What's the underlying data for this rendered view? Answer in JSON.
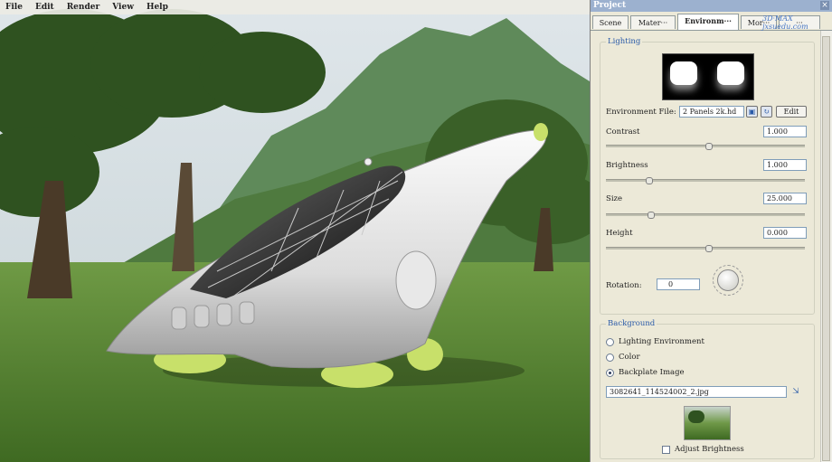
{
  "menu": [
    "File",
    "Edit",
    "Render",
    "View",
    "Help"
  ],
  "panel": {
    "title": "Project",
    "close_glyph": "×",
    "tabs": [
      "Scene",
      "Mater···",
      "Environm···",
      "Mor···",
      "···"
    ],
    "active_tab": 2,
    "watermark": "3D·MAX\njxsuedu.com",
    "lighting": {
      "label": "Lighting",
      "environment_file_label": "Environment File:",
      "environment_file_value": "2 Panels 2k.hd",
      "edit_label": "Edit",
      "contrast": {
        "label": "Contrast",
        "value": "1.000",
        "slider": 0.5
      },
      "brightness": {
        "label": "Brightness",
        "value": "1.000",
        "slider": 0.2
      },
      "size": {
        "label": "Size",
        "value": "25.000",
        "slider": 0.21
      },
      "height": {
        "label": "Height",
        "value": "0.000",
        "slider": 0.5
      },
      "rotation": {
        "label": "Rotation:",
        "value": "0"
      }
    },
    "background": {
      "label": "Background",
      "options": [
        "Lighting Environment",
        "Color",
        "Backplate Image"
      ],
      "selected": 2,
      "image_file": "3082641_114524002_2.jpg",
      "adjust_brightness_label": "Adjust Brightness"
    }
  },
  "icons": {
    "folder": "folder-icon",
    "refresh": "refresh-icon",
    "browse": "browse-icon"
  }
}
